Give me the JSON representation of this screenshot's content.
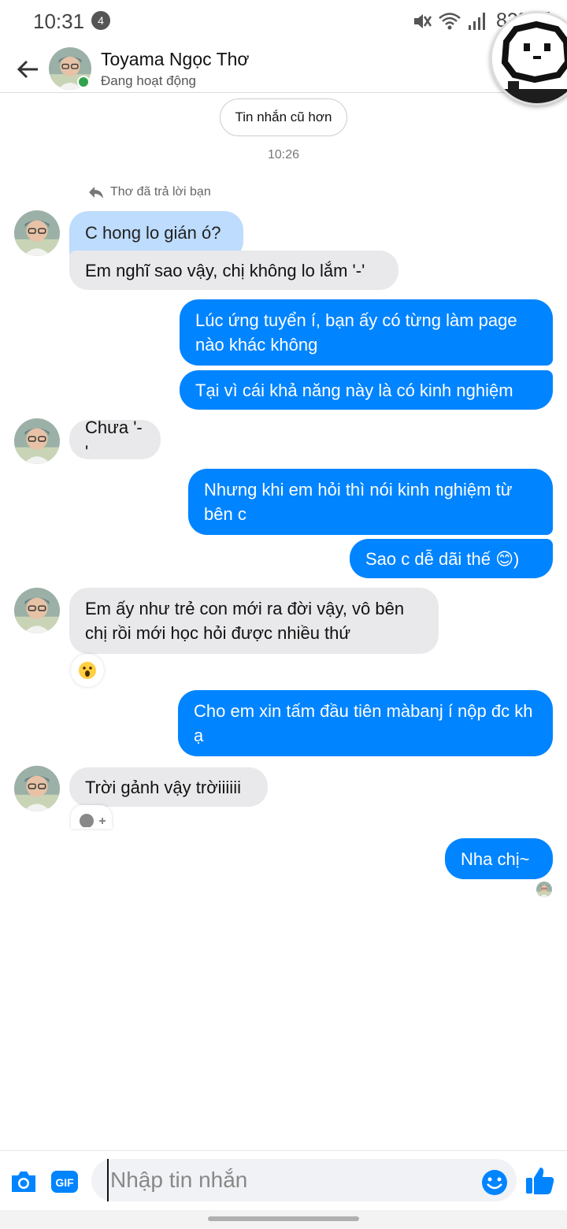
{
  "status_bar": {
    "time": "10:31",
    "notification_count": "4",
    "battery": "82%"
  },
  "header": {
    "contact_name": "Toyama Ngọc Thơ",
    "contact_status": "Đang hoạt động"
  },
  "chat": {
    "older_button": "Tin nhắn cũ hơn",
    "timestamp": "10:26",
    "reply_note": "Thơ đã trả lời bạn",
    "messages": [
      {
        "from": "them",
        "text": "C hong lo gián ó?"
      },
      {
        "from": "them",
        "text": "Em nghĩ sao vậy, chị không lo lắm '-'"
      },
      {
        "from": "me",
        "text": "Lúc ứng tuyển í, bạn ấy có từng làm page nào khác không"
      },
      {
        "from": "me",
        "text": "Tại vì cái khả năng này là có kinh nghiệm"
      },
      {
        "from": "them",
        "text": "Chưa '-'"
      },
      {
        "from": "me",
        "text": "Nhưng khi em hỏi thì nói kinh nghiệm từ bên c"
      },
      {
        "from": "me",
        "text": "Sao c dễ dãi thế 😊)"
      },
      {
        "from": "them",
        "text": "Em ấy như trẻ con mới ra đời vậy, vô bên chị rồi mới học hỏi được nhiều thứ"
      },
      {
        "from": "me",
        "text": "Cho em xin tấm đầu tiên màbanj í nộp đc kh ạ"
      },
      {
        "from": "them",
        "text": "Trời gảnh vậy trờiiiiii"
      },
      {
        "from": "me",
        "text": "Nha chị~"
      }
    ]
  },
  "composer": {
    "placeholder": "Nhập tin nhắn",
    "gif_label": "GIF"
  },
  "colors": {
    "accent": "#0084ff",
    "incoming_bubble": "#e9e9eb",
    "reply_bubble": "#bedcfd",
    "online": "#31a24c"
  }
}
